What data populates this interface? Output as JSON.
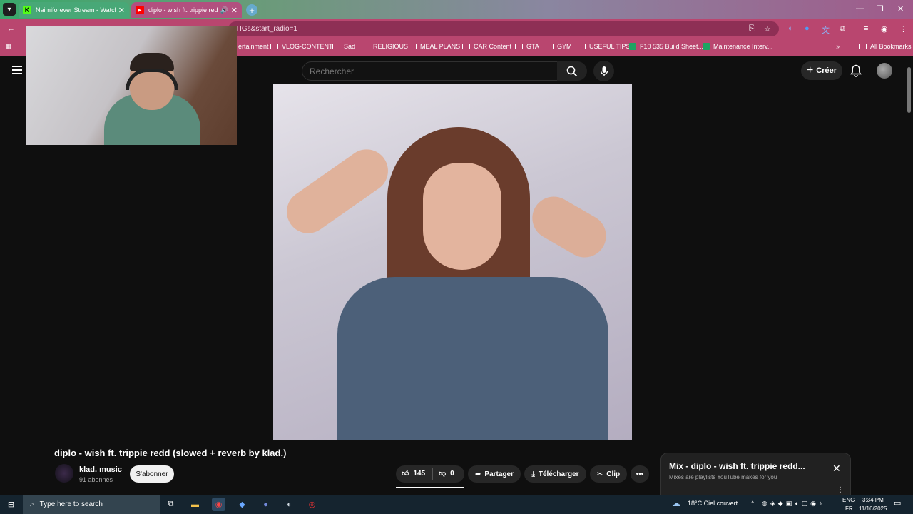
{
  "browser": {
    "tabs": [
      {
        "title": "Naimiforever Stream - Watch L",
        "favicon": "K"
      },
      {
        "title": "diplo - wish ft. trippie redd",
        "favicon": "▶"
      }
    ],
    "address": "TIGs&start_radio=1",
    "bookmarks": [
      {
        "label": "ertainment",
        "icon": "none"
      },
      {
        "label": "VLOG-CONTENT",
        "icon": "folder"
      },
      {
        "label": "Sad",
        "icon": "folder"
      },
      {
        "label": "RELIGIOUS",
        "icon": "folder"
      },
      {
        "label": "MEAL PLANS",
        "icon": "folder"
      },
      {
        "label": "CAR Content",
        "icon": "folder"
      },
      {
        "label": "GTA",
        "icon": "folder"
      },
      {
        "label": "GYM",
        "icon": "folder"
      },
      {
        "label": "USEFUL TIPS",
        "icon": "folder"
      },
      {
        "label": "F10 535 Build Sheet...",
        "icon": "sheets"
      },
      {
        "label": "Maintenance Interv...",
        "icon": "sheets"
      }
    ],
    "all_bookmarks": "All Bookmarks"
  },
  "youtube": {
    "search_placeholder": "Rechercher",
    "create_label": "Créer",
    "video_title": "diplo - wish ft. trippie redd (slowed + reverb by klad.)",
    "channel_name": "klad. music",
    "subscribers": "91 abonnés",
    "subscribe_label": "S'abonner",
    "likes": "145",
    "dislikes": "0",
    "share_label": "Partager",
    "download_label": "Télécharger",
    "clip_label": "Clip",
    "mix_title": "Mix - diplo - wish ft. trippie redd...",
    "mix_subtitle": "Mixes are playlists YouTube makes for you"
  },
  "taskbar": {
    "search_placeholder": "Type here to search",
    "weather": "18°C  Ciel couvert",
    "lang_top": "ENG",
    "lang_bottom": "FR",
    "time": "3:34 PM",
    "date": "11/16/2025"
  }
}
